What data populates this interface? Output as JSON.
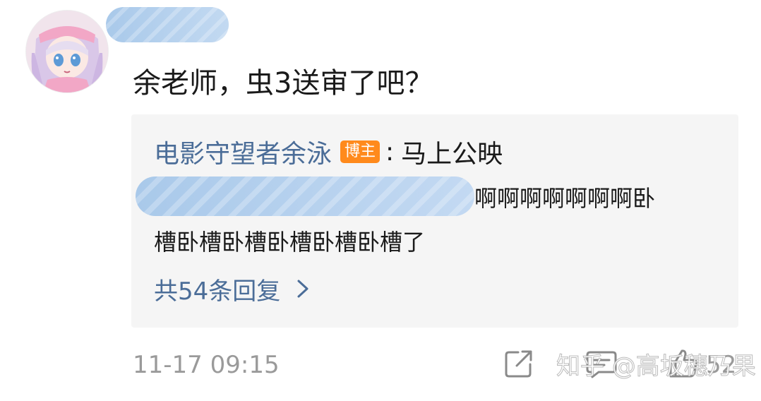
{
  "comment": {
    "text": "余老师，虫3送审了吧？"
  },
  "reply": {
    "user": "电影守望者余泳",
    "badge": "博主",
    "separator": ":",
    "text": "马上公映",
    "line1": "啊啊啊啊啊啊啊卧",
    "line2": "槽卧槽卧槽卧槽卧槽卧槽了",
    "count_label": "共54条回复"
  },
  "footer": {
    "timestamp": "11-17 09:15",
    "like_count": "52",
    "watermark": "知乎 @高坂穗乃果"
  },
  "colors": {
    "link": "#4b6d98",
    "badge": "#ff8a1c",
    "muted": "#9a9a9a",
    "reply_bg": "#f5f5f5"
  },
  "icons": {
    "share": "share-icon",
    "comment": "comment-icon",
    "like": "thumbs-up-icon",
    "expand": "chevron-right-icon"
  }
}
